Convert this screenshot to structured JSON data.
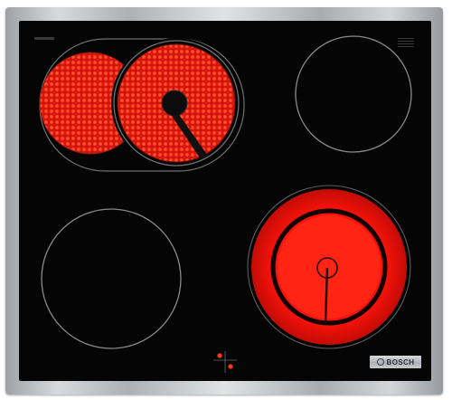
{
  "brand": {
    "name": "BOSCH",
    "mark_icon": "bosch-armature-logo"
  },
  "colors": {
    "frame": "#b5b8bb",
    "glass": "#050505",
    "zone_ring": "#8c8c8c",
    "heating_element": "#ff1a10",
    "control_dot": "#ff3a10"
  },
  "zones": [
    {
      "name": "rear-left",
      "heating": true,
      "type": "dual-ring oval"
    },
    {
      "name": "rear-right",
      "heating": false,
      "type": "single"
    },
    {
      "name": "front-left",
      "heating": false,
      "type": "single"
    },
    {
      "name": "front-right",
      "heating": true,
      "type": "dual-circuit"
    }
  ]
}
